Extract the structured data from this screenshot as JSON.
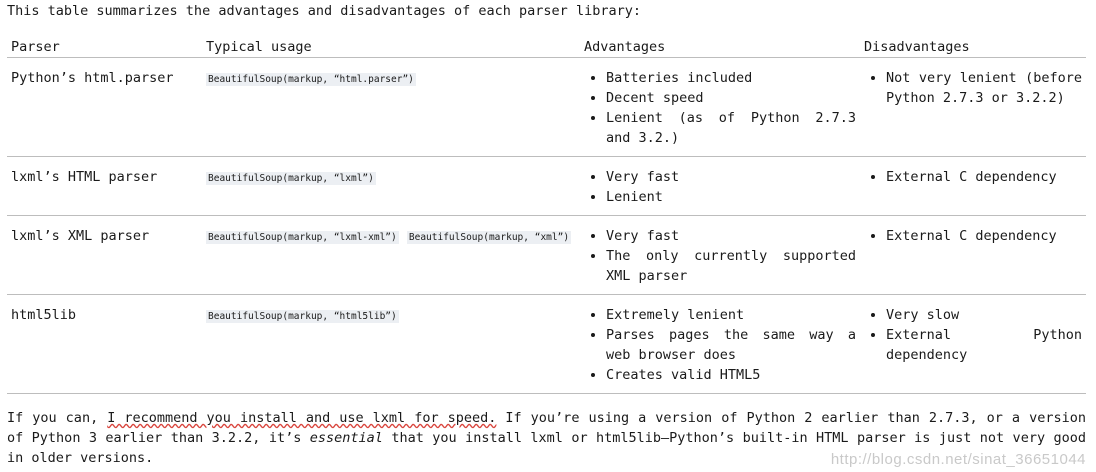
{
  "intro": "This table summarizes the advantages and disadvantages of each parser library:",
  "headers": [
    "Parser",
    "Typical usage",
    "Advantages",
    "Disadvantages"
  ],
  "rows": [
    {
      "parser": "Python’s html.parser",
      "usage": [
        "BeautifulSoup(markup, “html.parser”)"
      ],
      "advantages": [
        "Batteries included",
        "Decent speed",
        "Lenient (as of Python 2.7.3 and 3.2.)"
      ],
      "disadvantages": [
        "Not very lenient (before Python 2.7.3 or 3.2.2)"
      ]
    },
    {
      "parser": "lxml’s HTML parser",
      "usage": [
        "BeautifulSoup(markup, “lxml”)"
      ],
      "advantages": [
        "Very fast",
        "Lenient"
      ],
      "disadvantages": [
        "External C dependency"
      ]
    },
    {
      "parser": "lxml’s XML parser",
      "usage": [
        "BeautifulSoup(markup, “lxml-xml”)",
        "BeautifulSoup(markup, “xml”)"
      ],
      "advantages": [
        "Very fast",
        "The only currently supported XML parser"
      ],
      "disadvantages": [
        "External C dependency"
      ]
    },
    {
      "parser": "html5lib",
      "usage": [
        "BeautifulSoup(markup, “html5lib”)"
      ],
      "advantages": [
        "Extremely lenient",
        "Parses pages the same way a web browser does",
        "Creates valid HTML5"
      ],
      "disadvantages": [
        "Very slow",
        "External Python dependency"
      ]
    }
  ],
  "bottom": {
    "part1": "If you can, ",
    "underlined": "I recommend you install and use lxml for speed.",
    "part2": " If you’re using a version of Python 2 earlier than 2.7.3, or a version of Python 3 earlier than 3.2.2, it’s ",
    "emphasis": "essential",
    "part3": " that you install lxml or html5lib–Python’s built-in HTML parser is just not very good in older versions."
  },
  "watermark": "http://blog.csdn.net/sinat_36651044"
}
